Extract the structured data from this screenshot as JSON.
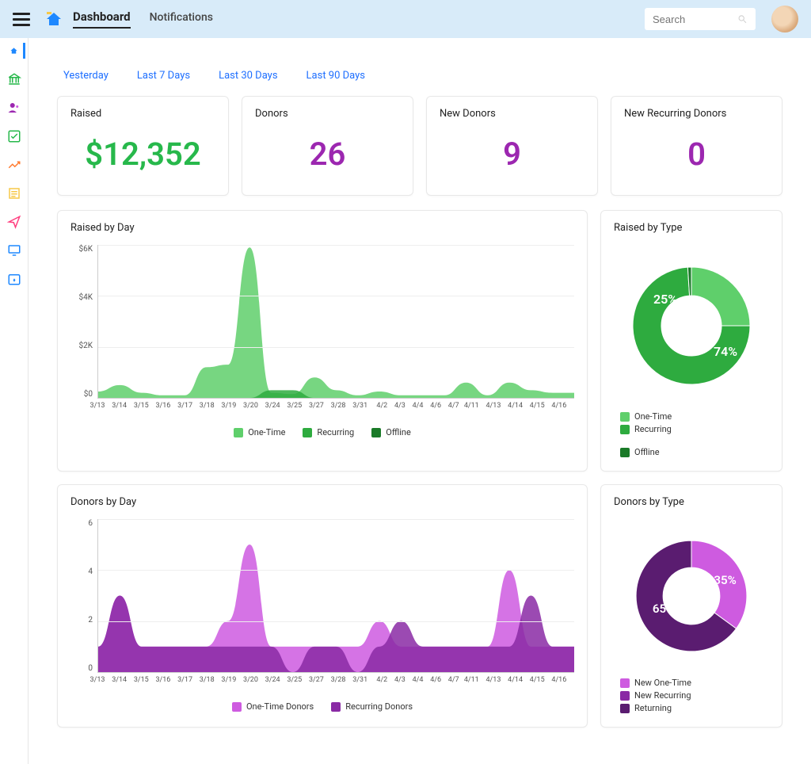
{
  "header": {
    "tabs": [
      "Dashboard",
      "Notifications"
    ],
    "search_placeholder": "Search"
  },
  "date_ranges": [
    "Yesterday",
    "Last 7 Days",
    "Last 30 Days",
    "Last 90 Days"
  ],
  "stats": [
    {
      "label": "Raised",
      "value": "$12,352",
      "color": "green"
    },
    {
      "label": "Donors",
      "value": "26",
      "color": "purple"
    },
    {
      "label": "New Donors",
      "value": "9",
      "color": "purple"
    },
    {
      "label": "New Recurring Donors",
      "value": "0",
      "color": "purple"
    }
  ],
  "raised_by_day": {
    "title": "Raised by Day",
    "ylabels": [
      "$6K",
      "$4K",
      "$2K",
      "$0"
    ],
    "legend": [
      "One-Time",
      "Recurring",
      "Offline"
    ],
    "colors": [
      "#5fcf6b",
      "#2eab3f",
      "#1a7a28"
    ]
  },
  "raised_by_type": {
    "title": "Raised by Type",
    "labels": [
      "25%",
      "74%"
    ],
    "legend": [
      "One-Time",
      "Recurring",
      "Offline"
    ],
    "colors": [
      "#5fcf6b",
      "#2eab3f",
      "#1a7a28"
    ]
  },
  "donors_by_day": {
    "title": "Donors by Day",
    "ylabels": [
      "6",
      "4",
      "2",
      "0"
    ],
    "legend": [
      "One-Time Donors",
      "Recurring Donors"
    ],
    "colors": [
      "#ce5be0",
      "#8a2aa5"
    ]
  },
  "donors_by_type": {
    "title": "Donors by Type",
    "labels": [
      "65%",
      "35%"
    ],
    "legend": [
      "New One-Time",
      "New Recurring",
      "Returning"
    ],
    "colors": [
      "#ce5be0",
      "#8a2aa5",
      "#5a1c70"
    ]
  },
  "xlabels": [
    "3/13",
    "3/14",
    "3/15",
    "3/16",
    "3/17",
    "3/18",
    "3/19",
    "3/20",
    "3/24",
    "3/25",
    "3/27",
    "3/28",
    "3/31",
    "4/2",
    "4/3",
    "4/4",
    "4/6",
    "4/7",
    "4/11",
    "4/13",
    "4/14",
    "4/15",
    "4/16"
  ],
  "chart_data": [
    {
      "type": "area",
      "title": "Raised by Day",
      "xlabel": "",
      "ylabel": "",
      "ylim": [
        0,
        6000
      ],
      "categories": [
        "3/13",
        "3/14",
        "3/15",
        "3/16",
        "3/17",
        "3/18",
        "3/19",
        "3/20",
        "3/24",
        "3/25",
        "3/27",
        "3/28",
        "3/31",
        "4/2",
        "4/3",
        "4/4",
        "4/6",
        "4/7",
        "4/11",
        "4/13",
        "4/14",
        "4/15",
        "4/16"
      ],
      "series": [
        {
          "name": "One-Time",
          "color": "#5fcf6b",
          "values": [
            250,
            500,
            200,
            100,
            100,
            1200,
            1300,
            5900,
            200,
            150,
            800,
            300,
            100,
            250,
            100,
            100,
            100,
            600,
            100,
            600,
            300,
            200,
            200
          ]
        },
        {
          "name": "Recurring",
          "color": "#2eab3f",
          "values": [
            0,
            0,
            0,
            0,
            0,
            0,
            0,
            0,
            300,
            300,
            0,
            0,
            0,
            0,
            0,
            0,
            0,
            0,
            0,
            0,
            0,
            0,
            0
          ]
        },
        {
          "name": "Offline",
          "color": "#1a7a28",
          "values": [
            0,
            0,
            0,
            0,
            0,
            0,
            0,
            0,
            0,
            0,
            0,
            0,
            0,
            0,
            0,
            0,
            0,
            0,
            0,
            0,
            0,
            0,
            0
          ]
        }
      ]
    },
    {
      "type": "pie",
      "title": "Raised by Type",
      "series": [
        {
          "name": "One-Time",
          "value": 25,
          "color": "#5fcf6b"
        },
        {
          "name": "Recurring",
          "value": 74,
          "color": "#2eab3f"
        },
        {
          "name": "Offline",
          "value": 1,
          "color": "#1a7a28"
        }
      ]
    },
    {
      "type": "area",
      "title": "Donors by Day",
      "xlabel": "",
      "ylabel": "",
      "ylim": [
        0,
        6
      ],
      "categories": [
        "3/13",
        "3/14",
        "3/15",
        "3/16",
        "3/17",
        "3/18",
        "3/19",
        "3/20",
        "3/24",
        "3/25",
        "3/27",
        "3/28",
        "3/31",
        "4/2",
        "4/3",
        "4/4",
        "4/6",
        "4/7",
        "4/11",
        "4/13",
        "4/14",
        "4/15",
        "4/16"
      ],
      "series": [
        {
          "name": "One-Time Donors",
          "color": "#ce5be0",
          "values": [
            1,
            3,
            1,
            1,
            1,
            1,
            2,
            5,
            1,
            1,
            1,
            1,
            1,
            2,
            1,
            1,
            1,
            1,
            1,
            4,
            1,
            1,
            1
          ]
        },
        {
          "name": "Recurring Donors",
          "color": "#8a2aa5",
          "values": [
            1,
            3,
            1,
            1,
            1,
            1,
            1,
            1,
            1,
            0,
            1,
            1,
            0,
            1,
            2,
            1,
            1,
            1,
            1,
            1,
            3,
            1,
            1
          ]
        }
      ]
    },
    {
      "type": "pie",
      "title": "Donors by Type",
      "series": [
        {
          "name": "New One-Time",
          "value": 35,
          "color": "#ce5be0"
        },
        {
          "name": "New Recurring",
          "value": 0,
          "color": "#8a2aa5"
        },
        {
          "name": "Returning",
          "value": 65,
          "color": "#5a1c70"
        }
      ]
    }
  ]
}
